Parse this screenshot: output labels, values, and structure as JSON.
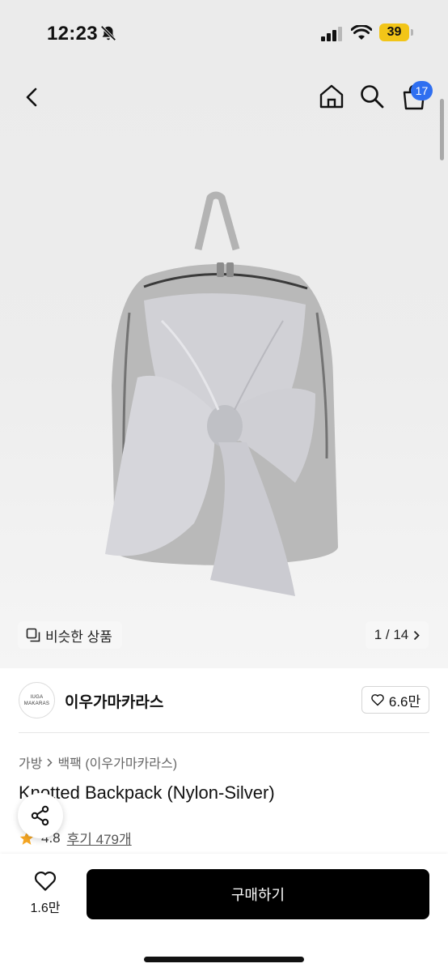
{
  "status_bar": {
    "time": "12:23",
    "battery": "39",
    "icons": [
      "bell-slash-icon",
      "signal-icon",
      "wifi-icon",
      "battery-icon"
    ],
    "battery_color": "#f2c518"
  },
  "nav": {
    "icons": [
      "back-icon",
      "home-icon",
      "search-icon",
      "cart-icon"
    ],
    "cart_count": "17",
    "badge_color": "#2f6ff0"
  },
  "gallery": {
    "similar_label": "비슷한 상품",
    "counter": "1 / 14"
  },
  "brand": {
    "logo_line1": "IUGA",
    "logo_line2": "MAKARAS",
    "name": "이우가마카라스",
    "likes": "6.6만"
  },
  "product": {
    "breadcrumb": [
      "가방",
      "백팩 (이우가마카라스)"
    ],
    "title": "Knotted Backpack (Nylon-Silver)",
    "rating": "4.8",
    "reviews": "후기 479개",
    "star_color": "#f5a623"
  },
  "bottom_bar": {
    "wish_count": "1.6만",
    "buy_label": "구매하기"
  }
}
